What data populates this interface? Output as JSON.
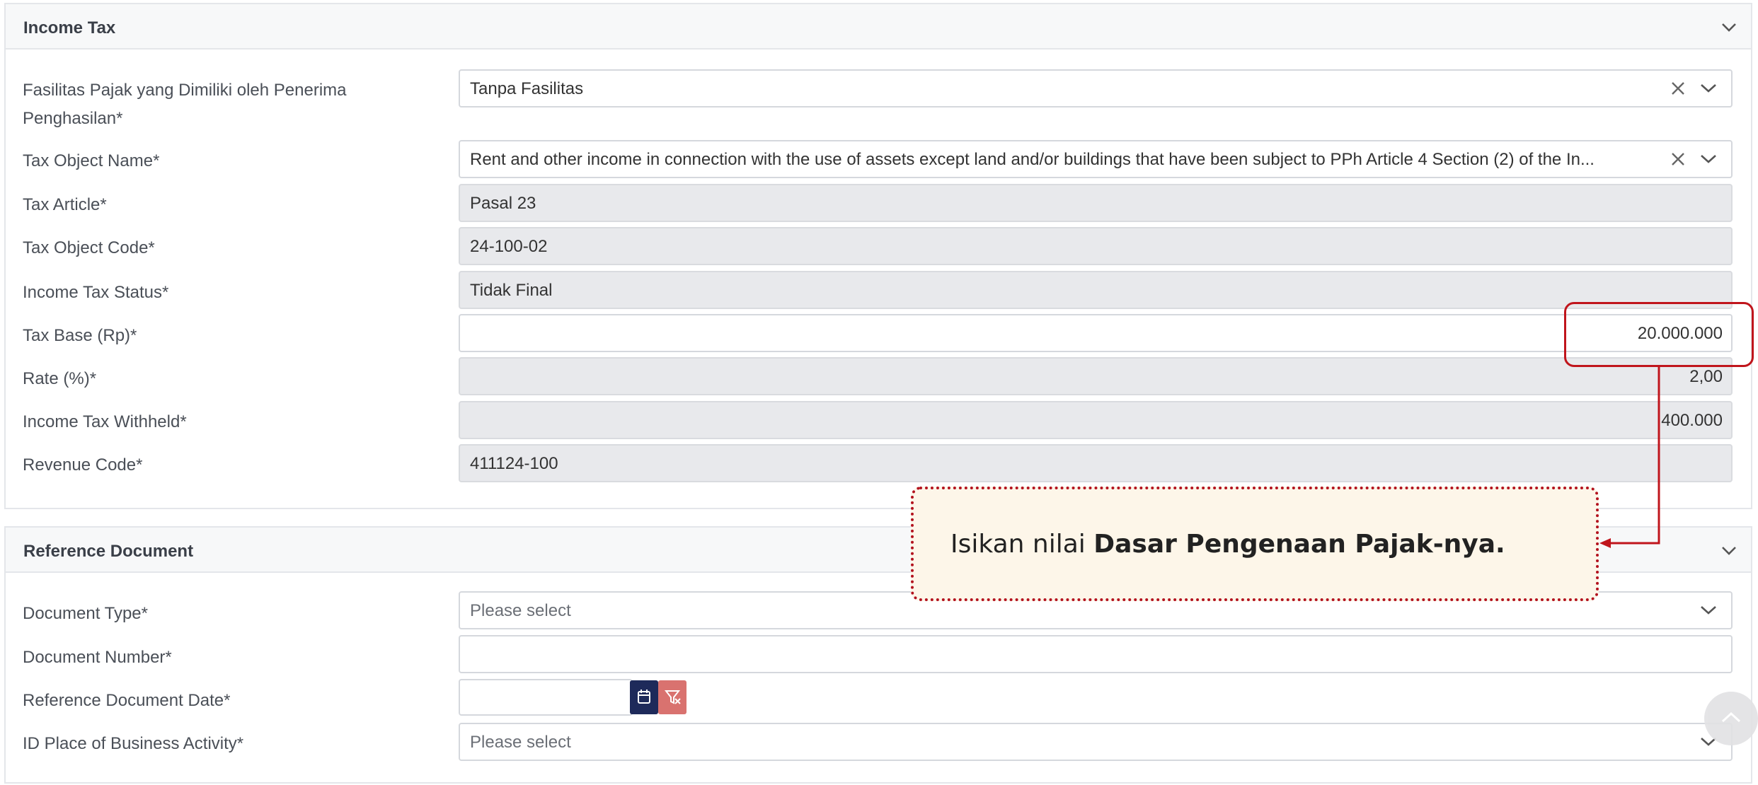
{
  "income_tax": {
    "title": "Income Tax",
    "fields": {
      "facility": {
        "label_line1": "Fasilitas Pajak yang Dimiliki oleh Penerima",
        "label_line2": "Penghasilan*",
        "value": "Tanpa Fasilitas"
      },
      "object_name": {
        "label": "Tax Object Name*",
        "value": "Rent and other income in connection with the use of assets except land and/or buildings that have been subject to PPh Article 4 Section (2) of the In..."
      },
      "article": {
        "label": "Tax Article*",
        "value": "Pasal 23"
      },
      "object_code": {
        "label": "Tax Object Code*",
        "value": "24-100-02"
      },
      "status": {
        "label": "Income Tax Status*",
        "value": "Tidak Final"
      },
      "tax_base": {
        "label": "Tax Base (Rp)*",
        "value": "20.000.000"
      },
      "rate": {
        "label": "Rate (%)*",
        "value": "2,00"
      },
      "withheld": {
        "label": "Income Tax Withheld*",
        "value": "400.000"
      },
      "revenue_code": {
        "label": "Revenue Code*",
        "value": "411124-100"
      }
    }
  },
  "reference_document": {
    "title": "Reference Document",
    "fields": {
      "doc_type": {
        "label": "Document Type*",
        "placeholder": "Please select"
      },
      "doc_number": {
        "label": "Document Number*",
        "value": ""
      },
      "doc_date": {
        "label": "Reference Document Date*",
        "value": ""
      },
      "place": {
        "label": "ID Place of Business Activity*",
        "placeholder": "Please select"
      }
    }
  },
  "callout": {
    "text_plain": "Isikan nilai ",
    "text_bold": "Dasar Pengenaan Pajak-nya."
  },
  "icons": {
    "chevron": "chevron-down-icon",
    "clear": "close-icon",
    "calendar": "calendar-icon",
    "clear_filter": "filter-clear-icon",
    "scroll_top": "chevron-up-icon"
  },
  "colors": {
    "accent_red": "#c0151c",
    "calendar_button": "#1e2a5a",
    "clear_filter_button": "#d9726f",
    "callout_bg": "#fdf6e9"
  }
}
